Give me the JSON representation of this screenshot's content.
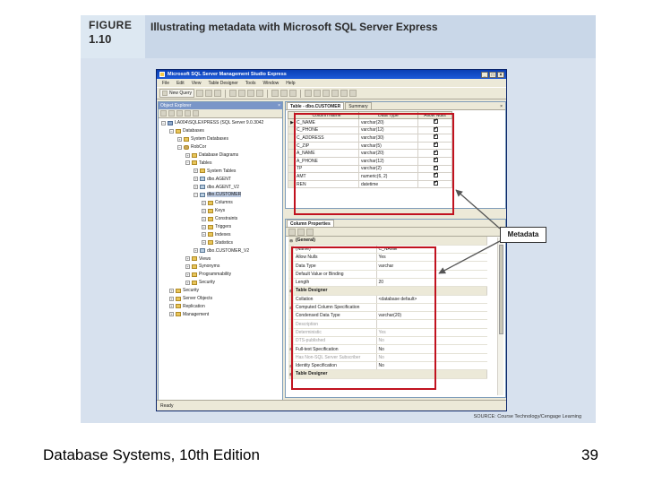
{
  "figure": {
    "label_line1": "FIGURE",
    "label_line2": "1.10",
    "title": "Illustrating metadata with Microsoft SQL Server Express",
    "source": "SOURCE: Course Technology/Cengage Learning",
    "callout": "Metadata",
    "accent_color": "#c1121f"
  },
  "app": {
    "window_title": "Microsoft SQL Server Management Studio Express",
    "menu": [
      "File",
      "Edit",
      "View",
      "Table Designer",
      "Tools",
      "Window",
      "Help"
    ],
    "new_query_label": "New Query",
    "status": "Ready"
  },
  "object_explorer": {
    "title": "Object Explorer",
    "tree": [
      {
        "label": "LA004\\SQLEXPRESS (SQL Server 9.0.3042",
        "depth": 0,
        "expander": "−",
        "icon": "server-icon"
      },
      {
        "label": "Databases",
        "depth": 1,
        "expander": "−",
        "icon": "folder-icon"
      },
      {
        "label": "System Databases",
        "depth": 2,
        "expander": "+",
        "icon": "folder-icon"
      },
      {
        "label": "RobCor",
        "depth": 2,
        "expander": "−",
        "icon": "database-icon"
      },
      {
        "label": "Database Diagrams",
        "depth": 3,
        "expander": "+",
        "icon": "folder-icon"
      },
      {
        "label": "Tables",
        "depth": 3,
        "expander": "−",
        "icon": "folder-icon"
      },
      {
        "label": "System Tables",
        "depth": 4,
        "expander": "+",
        "icon": "folder-icon"
      },
      {
        "label": "dbo.AGENT",
        "depth": 4,
        "expander": "+",
        "icon": "table-icon"
      },
      {
        "label": "dbo.AGENT_V2",
        "depth": 4,
        "expander": "+",
        "icon": "table-icon"
      },
      {
        "label": "dbo.CUSTOMER",
        "depth": 4,
        "expander": "−",
        "icon": "table-icon",
        "selected": true
      },
      {
        "label": "Columns",
        "depth": 5,
        "expander": "+",
        "icon": "folder-icon"
      },
      {
        "label": "Keys",
        "depth": 5,
        "expander": "+",
        "icon": "folder-icon"
      },
      {
        "label": "Constraints",
        "depth": 5,
        "expander": "+",
        "icon": "folder-icon"
      },
      {
        "label": "Triggers",
        "depth": 5,
        "expander": "+",
        "icon": "folder-icon"
      },
      {
        "label": "Indexes",
        "depth": 5,
        "expander": "+",
        "icon": "folder-icon"
      },
      {
        "label": "Statistics",
        "depth": 5,
        "expander": "+",
        "icon": "folder-icon"
      },
      {
        "label": "dbo.CUSTOMER_V2",
        "depth": 4,
        "expander": "+",
        "icon": "table-icon"
      },
      {
        "label": "Views",
        "depth": 3,
        "expander": "+",
        "icon": "folder-icon"
      },
      {
        "label": "Synonyms",
        "depth": 3,
        "expander": "+",
        "icon": "folder-icon"
      },
      {
        "label": "Programmability",
        "depth": 3,
        "expander": "+",
        "icon": "folder-icon"
      },
      {
        "label": "Security",
        "depth": 3,
        "expander": "+",
        "icon": "folder-icon"
      },
      {
        "label": "Security",
        "depth": 1,
        "expander": "+",
        "icon": "folder-icon"
      },
      {
        "label": "Server Objects",
        "depth": 1,
        "expander": "+",
        "icon": "folder-icon"
      },
      {
        "label": "Replication",
        "depth": 1,
        "expander": "+",
        "icon": "folder-icon"
      },
      {
        "label": "Management",
        "depth": 1,
        "expander": "+",
        "icon": "folder-icon"
      }
    ]
  },
  "designer": {
    "tabs": [
      "Table - dbo.CUSTOMER",
      "Summary"
    ],
    "headers": [
      "Column Name",
      "Data Type",
      "Allow Nulls"
    ],
    "rows": [
      {
        "name": "C_NAME",
        "type": "varchar(20)",
        "nulls": true,
        "current": true
      },
      {
        "name": "C_PHONE",
        "type": "varchar(12)",
        "nulls": true
      },
      {
        "name": "C_ADDRESS",
        "type": "varchar(30)",
        "nulls": true
      },
      {
        "name": "C_ZIP",
        "type": "varchar(5)",
        "nulls": true
      },
      {
        "name": "A_NAME",
        "type": "varchar(20)",
        "nulls": true
      },
      {
        "name": "A_PHONE",
        "type": "varchar(12)",
        "nulls": true
      },
      {
        "name": "TP",
        "type": "varchar(2)",
        "nulls": true
      },
      {
        "name": "AMT",
        "type": "numeric(6, 2)",
        "nulls": true
      },
      {
        "name": "REN",
        "type": "datetime",
        "nulls": true
      }
    ]
  },
  "properties": {
    "tab": "Column Properties",
    "rows": [
      {
        "kind": "cat",
        "key": "(General)",
        "expander": "−"
      },
      {
        "key": "(Name)",
        "value": "C_NAME"
      },
      {
        "key": "Allow Nulls",
        "value": "Yes"
      },
      {
        "key": "Data Type",
        "value": "varchar"
      },
      {
        "key": "Default Value or Binding",
        "value": ""
      },
      {
        "key": "Length",
        "value": "20"
      },
      {
        "kind": "cat",
        "key": "Table Designer",
        "expander": "−"
      },
      {
        "key": "Collation",
        "value": "<database default>"
      },
      {
        "key": "Computed Column Specification",
        "value": "",
        "expander": "+"
      },
      {
        "key": "Condensed Data Type",
        "value": "varchar(20)"
      },
      {
        "key": "Description",
        "value": "",
        "dim": true
      },
      {
        "key": "Deterministic",
        "value": "Yes",
        "dim": true
      },
      {
        "key": "DTS-published",
        "value": "No",
        "dim": true
      },
      {
        "key": "Full-text Specification",
        "value": "No",
        "expander": "+"
      },
      {
        "key": "Has Non-SQL Server Subscriber",
        "value": "No",
        "dim": true
      },
      {
        "key": "Identity Specification",
        "value": "No",
        "expander": "+"
      },
      {
        "kind": "cat",
        "key": "Table Designer",
        "expander": "−"
      }
    ]
  },
  "footer": {
    "left": "Database Systems, 10th Edition",
    "page": "39"
  }
}
